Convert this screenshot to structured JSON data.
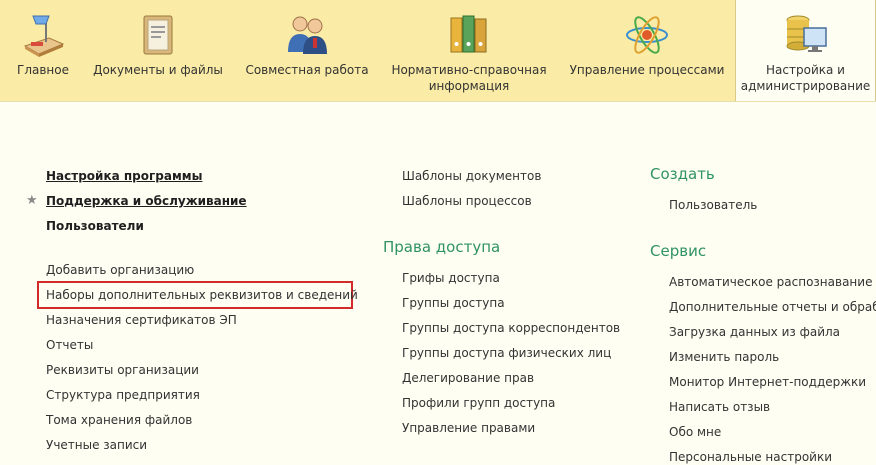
{
  "sections": [
    {
      "label": "Главное",
      "icon": "home-desk-icon"
    },
    {
      "label": "Документы и файлы",
      "icon": "documents-folder-icon"
    },
    {
      "label": "Совместная работа",
      "icon": "people-collaboration-icon"
    },
    {
      "label": "Нормативно-справочная\nинформация",
      "icon": "binders-icon"
    },
    {
      "label": "Управление процессами",
      "icon": "process-atom-icon"
    },
    {
      "label": "Настройка и\nадминистрирование",
      "icon": "database-monitor-icon"
    }
  ],
  "col1": {
    "settings": "Настройка программы",
    "support": "Поддержка и обслуживание",
    "users": "Пользователи",
    "links": [
      "Добавить организацию",
      "Наборы дополнительных реквизитов и сведений",
      "Назначения сертификатов ЭП",
      "Отчеты",
      "Реквизиты организации",
      "Структура предприятия",
      "Тома хранения файлов",
      "Учетные записи"
    ]
  },
  "col2": {
    "top_links": [
      "Шаблоны документов",
      "Шаблоны процессов"
    ],
    "access_title": "Права доступа",
    "access_links": [
      "Грифы доступа",
      "Группы доступа",
      "Группы доступа корреспондентов",
      "Группы доступа физических лиц",
      "Делегирование прав",
      "Профили групп доступа",
      "Управление правами"
    ]
  },
  "col3": {
    "create_title": "Создать",
    "create_links": [
      "Пользователь"
    ],
    "service_title": "Сервис",
    "service_links": [
      "Автоматическое распознавание из",
      "Дополнительные отчеты и обрабо",
      "Загрузка данных из файла",
      "Изменить пароль",
      "Монитор Интернет-поддержки",
      "Написать отзыв",
      "Обо мне",
      "Персональные настройки"
    ]
  },
  "colors": {
    "accent_green": "#2f9364",
    "highlight_red": "#d32a2a",
    "topbar": "#faeca6"
  }
}
